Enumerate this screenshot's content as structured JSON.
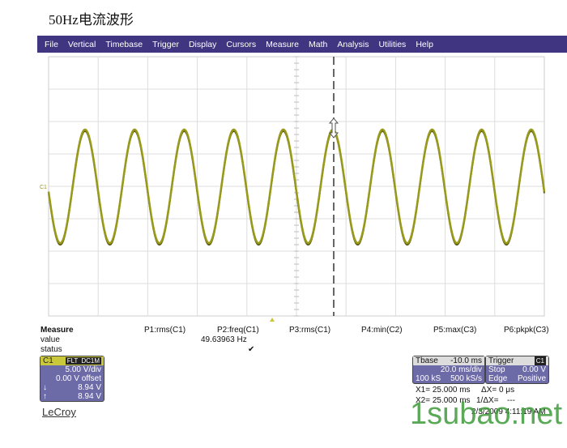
{
  "title": "50Hz电流波形",
  "menu": [
    "File",
    "Vertical",
    "Timebase",
    "Trigger",
    "Display",
    "Cursors",
    "Measure",
    "Math",
    "Analysis",
    "Utilities",
    "Help"
  ],
  "trace": {
    "color": "#9a9a1a",
    "frequency_hz": 49.63963,
    "cycles_visible": 10,
    "volts_per_div": 5.0,
    "peak_v": 8.94
  },
  "measure": {
    "title": "Measure",
    "value_label": "value",
    "status_label": "status",
    "params": [
      {
        "name": "P1:rms(C1)",
        "value": "",
        "status": ""
      },
      {
        "name": "P2:freq(C1)",
        "value": "49.63963 Hz",
        "status": "✔"
      },
      {
        "name": "P3:rms(C1)",
        "value": "",
        "status": ""
      },
      {
        "name": "P4:min(C2)",
        "value": "",
        "status": ""
      },
      {
        "name": "P5:max(C3)",
        "value": "",
        "status": ""
      },
      {
        "name": "P6:pkpk(C3)",
        "value": "",
        "status": ""
      }
    ]
  },
  "channel": {
    "name": "C1",
    "tag1": "FLT",
    "tag2": "DC1M",
    "vdiv": "5.00 V/div",
    "offset": "0.00 V offset",
    "down": "8.94 V",
    "up": "8.94 V",
    "down_icon": "↓",
    "up_icon": "↑"
  },
  "timebase": {
    "label": "Tbase",
    "delay": "-10.0 ms",
    "tdiv": "20.0 ms/div",
    "samples": "100 kS",
    "rate": "500 kS/s"
  },
  "trigger": {
    "label": "Trigger",
    "source": "C1",
    "mode": "Stop",
    "level": "0.00 V",
    "type": "Edge",
    "slope": "Positive"
  },
  "cursors": {
    "x1": "X1=  25.000 ms",
    "dx": "ΔX=  0 μs",
    "x2": "X2=  25.000 ms",
    "inv_dx": "1/ΔX=",
    "inv_dx_val": "---"
  },
  "datetime": "2/3/2009 4:11:19 AM",
  "brand": "LeCroy",
  "watermark": "1subao.net",
  "channel_marker": "C1"
}
